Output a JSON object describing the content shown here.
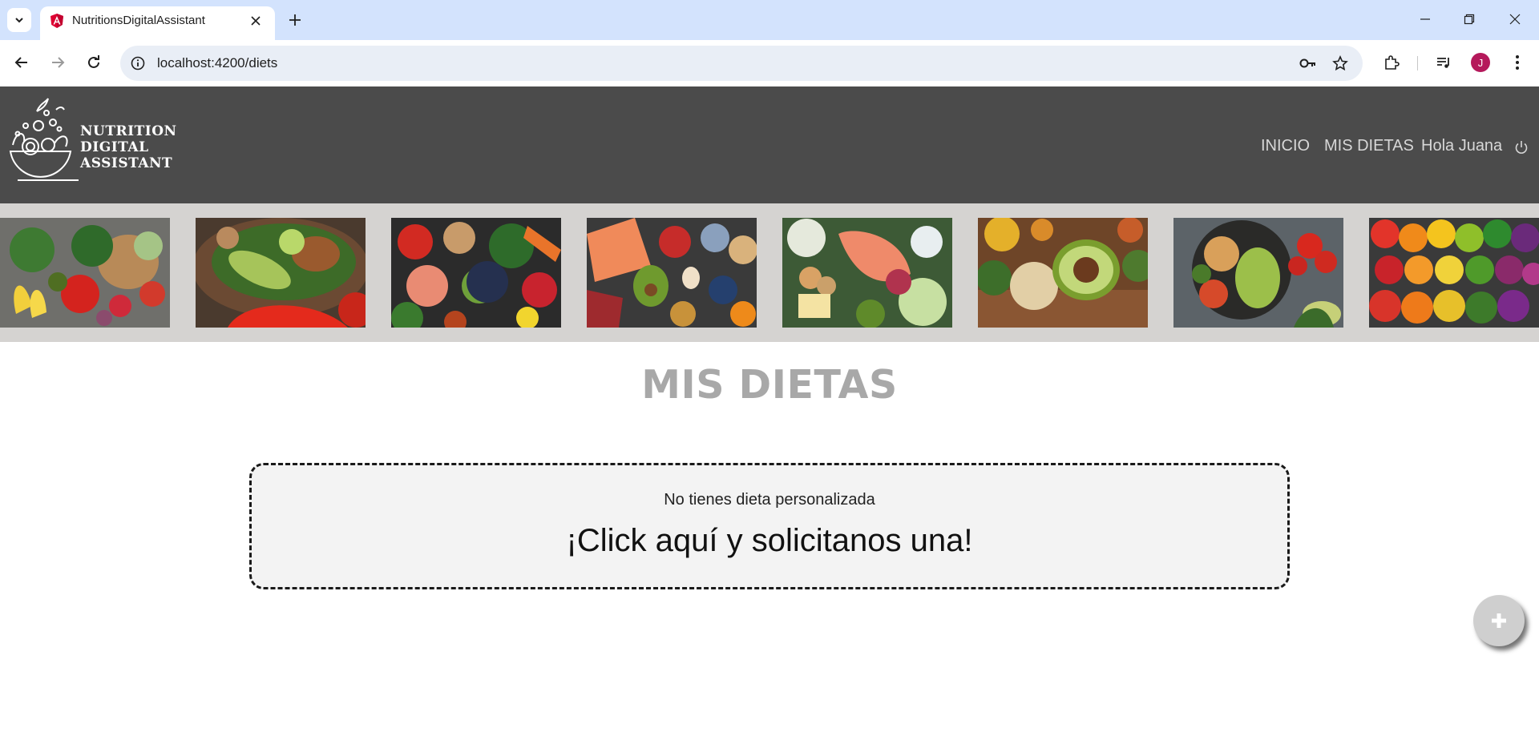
{
  "browser": {
    "tab_title": "NutritionsDigitalAssistant",
    "url": "localhost:4200/diets",
    "profile_initial": "J"
  },
  "app": {
    "logo_lines": [
      "NUTRITION",
      "DIGITAL",
      "ASSISTANT"
    ],
    "nav": {
      "home": "INICIO",
      "diets": "MIS DIETAS",
      "greeting": "Hola Juana"
    }
  },
  "strip": {
    "images": [
      "vegetables-bread-fruit",
      "salad-avocado-pepper",
      "tomatoes-broccoli-berries",
      "salmon-meat-avocado-eggs",
      "salmon-eggs-cheese-greens",
      "avocado-spices-oats",
      "chickpea-avocado-salad",
      "rainbow-fruits-vegetables"
    ]
  },
  "main": {
    "title": "MIS DIETAS",
    "empty_message": "No tienes dieta personalizada",
    "cta": "¡Click aquí y solicitanos una!"
  },
  "colors": {
    "header_bg": "#4b4b4b",
    "strip_bg": "#d5d3d1",
    "title_color": "#a8a8a8",
    "card_bg": "#f3f3f3",
    "tabstrip_bg": "#d3e3fd"
  }
}
